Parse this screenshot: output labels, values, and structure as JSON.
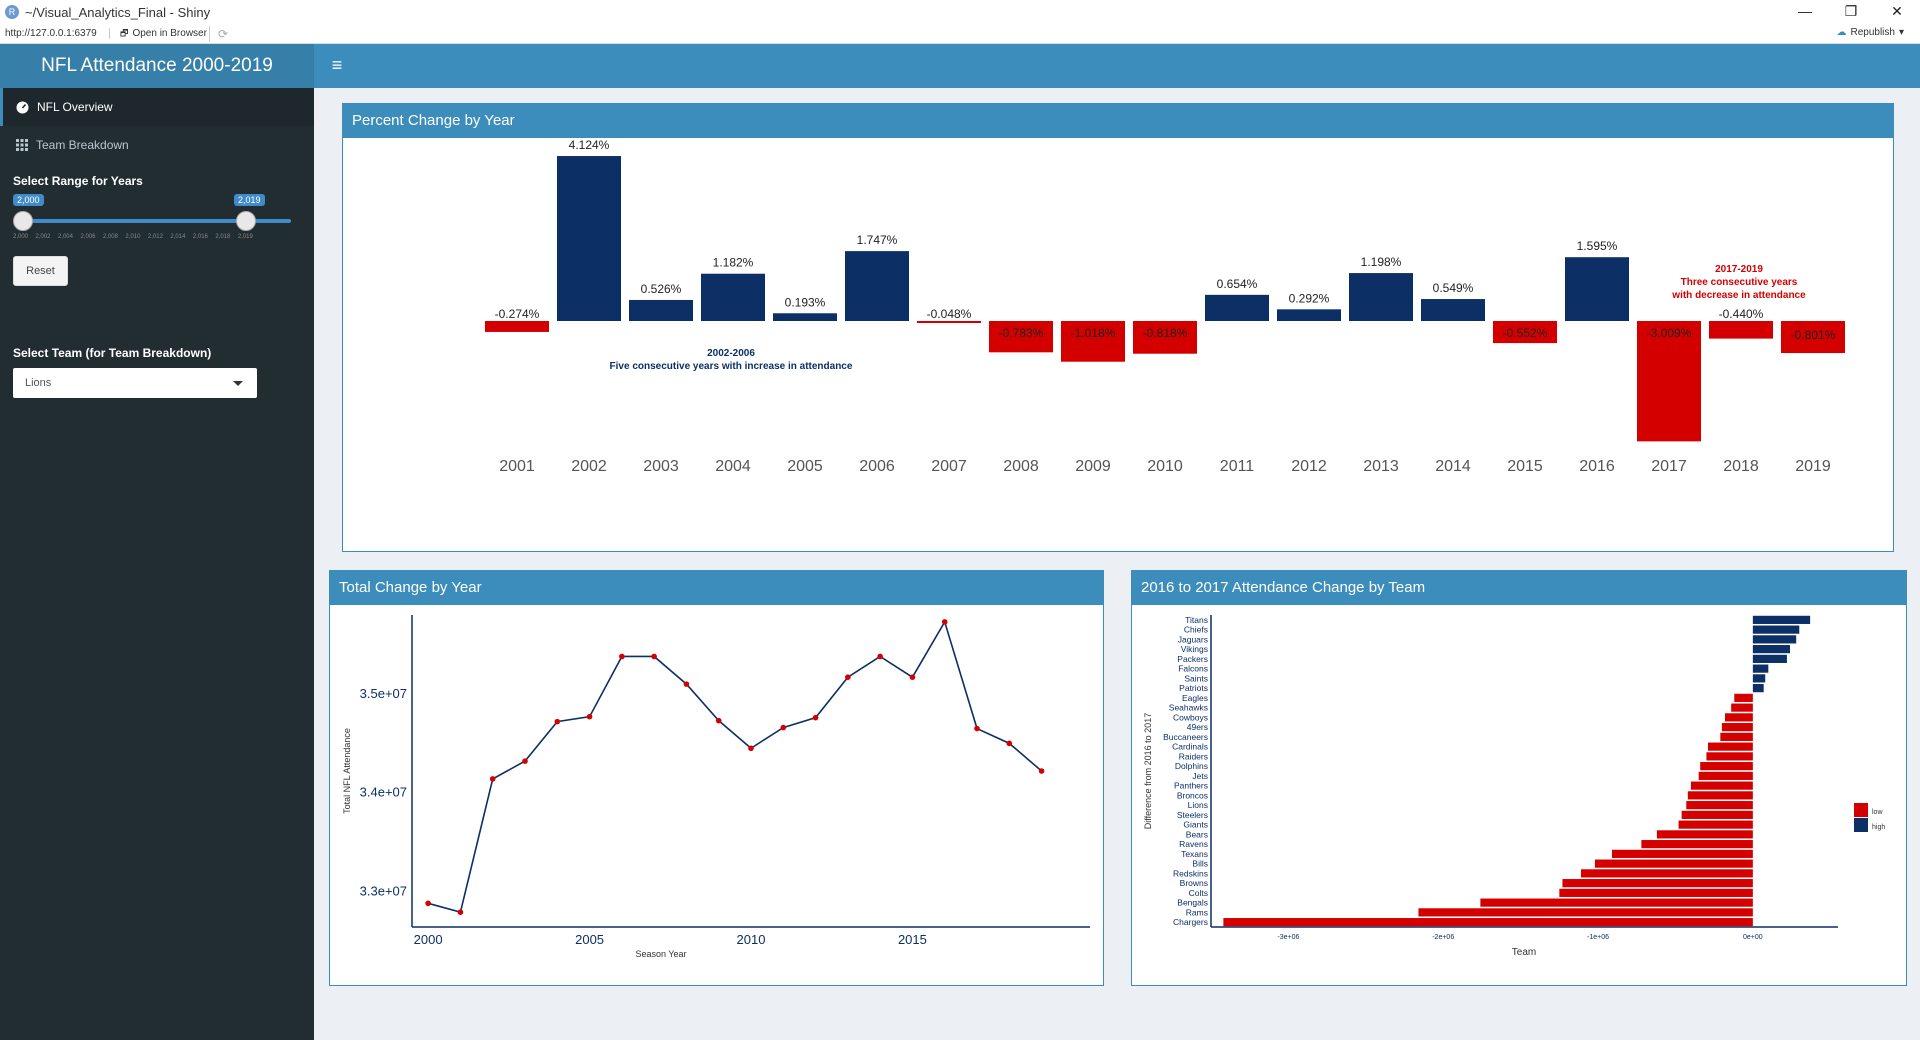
{
  "window": {
    "title": "~/Visual_Analytics_Final - Shiny",
    "controls": [
      "—",
      "❐",
      "✕"
    ]
  },
  "addressbar": {
    "url": "http://127.0.0.1:6379",
    "open_in_browser": "Open in Browser",
    "republish": "Republish"
  },
  "header": {
    "title": "NFL Attendance 2000-2019",
    "toggle_glyph": "≡"
  },
  "sidebar": {
    "items": [
      {
        "label": "NFL Overview",
        "icon": "dashboard-icon",
        "active": true
      },
      {
        "label": "Team Breakdown",
        "icon": "grid-icon",
        "active": false
      }
    ],
    "year_range": {
      "label": "Select Range for Years",
      "min_badge": "2,000",
      "max_badge": "2,019",
      "ticks": [
        "2,000",
        "2,002",
        "2,004",
        "2,006",
        "2,008",
        "2,010",
        "2,012",
        "2,014",
        "2,016",
        "2,018",
        "2,019"
      ]
    },
    "reset_label": "Reset",
    "team_select": {
      "label": "Select Team (for Team Breakdown)",
      "value": "Lions"
    }
  },
  "boxes": {
    "percent_title": "Percent Change by Year",
    "total_title": "Total Change by Year",
    "team_title": "2016 to 2017 Attendance Change by Team"
  },
  "colors": {
    "increase": "#0c2f66",
    "decrease": "#d40000",
    "header": "#3c8dbc",
    "sidebar": "#222d32"
  },
  "chart_data": [
    {
      "type": "bar",
      "title": "Percent Change by Year",
      "categories": [
        "2001",
        "2002",
        "2003",
        "2004",
        "2005",
        "2006",
        "2007",
        "2008",
        "2009",
        "2010",
        "2011",
        "2012",
        "2013",
        "2014",
        "2015",
        "2016",
        "2017",
        "2018",
        "2019"
      ],
      "values": [
        -0.274,
        4.124,
        0.526,
        1.182,
        0.193,
        1.747,
        -0.048,
        -0.783,
        -1.018,
        -0.818,
        0.654,
        0.292,
        1.198,
        0.549,
        -0.552,
        1.595,
        -3.009,
        -0.44,
        -0.801
      ],
      "labels": [
        "-0.274%",
        "4.124%",
        "0.526%",
        "1.182%",
        "0.193%",
        "1.747%",
        "-0.048%",
        "-0.783%",
        "-1.018%",
        "-0.818%",
        "0.654%",
        "0.292%",
        "1.198%",
        "0.549%",
        "-0.552%",
        "1.595%",
        "-3.009%",
        "-0.440%",
        "-0.801%"
      ],
      "annotations": [
        {
          "lines": [
            "2002-2006",
            "Five consecutive years with increase in attendance"
          ],
          "color": "increase"
        },
        {
          "lines": [
            "2017-2019",
            "Three consecutive years",
            "with decrease in attendance"
          ],
          "color": "decrease"
        }
      ]
    },
    {
      "type": "line",
      "title": "Total Change by Year",
      "xlabel": "Season Year",
      "ylabel": "Total NFL Attendance",
      "x": [
        2000,
        2001,
        2002,
        2003,
        2004,
        2005,
        2006,
        2007,
        2008,
        2009,
        2010,
        2011,
        2012,
        2013,
        2014,
        2015,
        2016,
        2017,
        2018,
        2019
      ],
      "y": [
        32870000,
        32780000,
        34130000,
        34310000,
        34710000,
        34760000,
        35370000,
        35370000,
        35090000,
        34720000,
        34440000,
        34650000,
        34750000,
        35160000,
        35370000,
        35160000,
        35720000,
        34640000,
        34490000,
        34210000
      ],
      "xticks": [
        "2000",
        "2005",
        "2010",
        "2015"
      ],
      "yticks": [
        "3.3e+07",
        "3.4e+07",
        "3.5e+07"
      ],
      "xlim": [
        1999.5,
        2020.5
      ],
      "ylim": [
        32630000,
        35790000
      ]
    },
    {
      "type": "bar",
      "orientation": "horizontal",
      "title": "2016 to 2017 Attendance Change by Team",
      "xlabel": "Team",
      "ylabel": "Difference from 2016 to 2017",
      "categories": [
        "Titans",
        "Chiefs",
        "Jaguars",
        "Vikings",
        "Packers",
        "Falcons",
        "Saints",
        "Patriots",
        "Eagles",
        "Seahawks",
        "Cowboys",
        "49ers",
        "Buccaneers",
        "Cardinals",
        "Raiders",
        "Dolphins",
        "Jets",
        "Panthers",
        "Broncos",
        "Lions",
        "Steelers",
        "Giants",
        "Bears",
        "Ravens",
        "Texans",
        "Bills",
        "Redskins",
        "Browns",
        "Colts",
        "Bengals",
        "Rams",
        "Chargers"
      ],
      "values": [
        370000,
        300000,
        280000,
        240000,
        220000,
        100000,
        80000,
        70000,
        -120000,
        -140000,
        -180000,
        -200000,
        -210000,
        -290000,
        -300000,
        -340000,
        -350000,
        -400000,
        -420000,
        -430000,
        -460000,
        -480000,
        -620000,
        -720000,
        -910000,
        -1020000,
        -1110000,
        -1230000,
        -1250000,
        -1760000,
        -2160000,
        -3420000
      ],
      "groups": [
        "high",
        "high",
        "high",
        "high",
        "high",
        "high",
        "high",
        "high",
        "low",
        "low",
        "low",
        "low",
        "low",
        "low",
        "low",
        "low",
        "low",
        "low",
        "low",
        "low",
        "low",
        "low",
        "low",
        "low",
        "low",
        "low",
        "low",
        "low",
        "low",
        "low",
        "low",
        "low"
      ],
      "xticks": [
        "-3e+06",
        "-2e+06",
        "-1e+06",
        "0e+00"
      ],
      "xlim": [
        -3500000,
        550000
      ],
      "legend": {
        "entries": [
          "low",
          "high"
        ],
        "placement": "right"
      }
    }
  ]
}
